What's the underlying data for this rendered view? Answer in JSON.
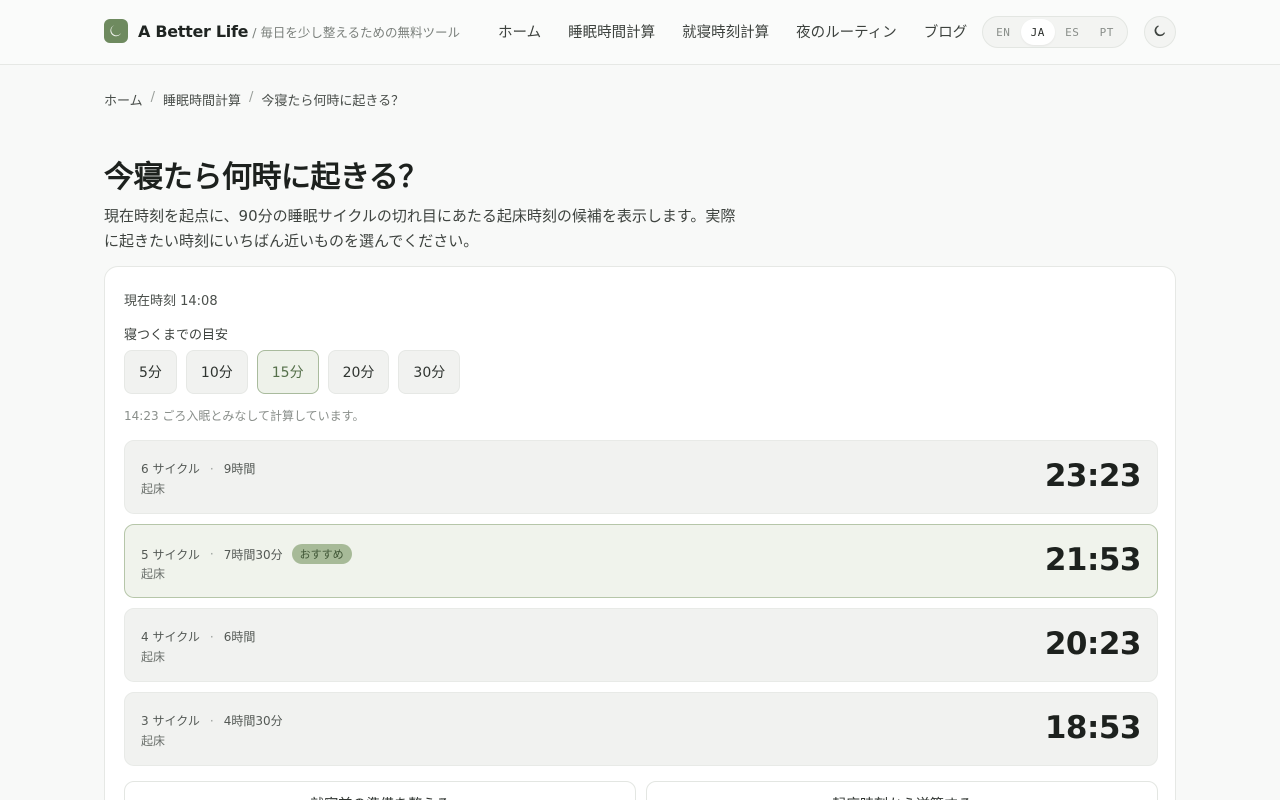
{
  "header": {
    "brand_name": "A Better Life",
    "brand_tagline": "/ 毎日を少し整えるための無料ツール",
    "logo_icon": "moon-icon",
    "nav": [
      {
        "label": "ホーム"
      },
      {
        "label": "睡眠時間計算"
      },
      {
        "label": "就寝時刻計算"
      },
      {
        "label": "夜のルーティン"
      },
      {
        "label": "ブログ"
      }
    ],
    "languages": [
      {
        "code": "EN",
        "active": false
      },
      {
        "code": "JA",
        "active": true
      },
      {
        "code": "ES",
        "active": false
      },
      {
        "code": "PT",
        "active": false
      }
    ],
    "theme_toggle_icon": "moon-icon"
  },
  "breadcrumb": {
    "home": "ホーム",
    "parent": "睡眠時間計算",
    "current": "今寝たら何時に起きる？",
    "separator": "/"
  },
  "page": {
    "title": "今寝たら何時に起きる？",
    "lead": "現在時刻を起点に、90分の睡眠サイクルの切れ目にあたる起床時刻の候補を表示します。実際に起きたい時刻にいちばん近いものを選んでください。"
  },
  "calculator": {
    "current_time": "現在時刻 14:08",
    "latency_label": "寝つくまでの目安",
    "latency_options": [
      {
        "label": "5分",
        "active": false
      },
      {
        "label": "10分",
        "active": false
      },
      {
        "label": "15分",
        "active": true
      },
      {
        "label": "20分",
        "active": false
      },
      {
        "label": "30分",
        "active": false
      }
    ],
    "asleep_note": "14:23 ごろ入眠とみなして計算しています。",
    "results": [
      {
        "cycles": "6 サイクル",
        "duration": "9時間",
        "label": "起床",
        "time": "23:23",
        "recommended": false
      },
      {
        "cycles": "5 サイクル",
        "duration": "7時間30分",
        "label": "起床",
        "time": "21:53",
        "recommended": true,
        "badge": "おすすめ"
      },
      {
        "cycles": "4 サイクル",
        "duration": "6時間",
        "label": "起床",
        "time": "20:23",
        "recommended": false
      },
      {
        "cycles": "3 サイクル",
        "duration": "4時間30分",
        "label": "起床",
        "time": "18:53",
        "recommended": false
      }
    ],
    "meta_separator": "·",
    "actions": [
      {
        "label": "就寝前の準備を整える"
      },
      {
        "label": "起床時刻から逆算する"
      }
    ]
  },
  "colors": {
    "accent": "#6e8a5f",
    "accent_soft": "#eef2ea",
    "badge_bg": "#a7ba98"
  }
}
